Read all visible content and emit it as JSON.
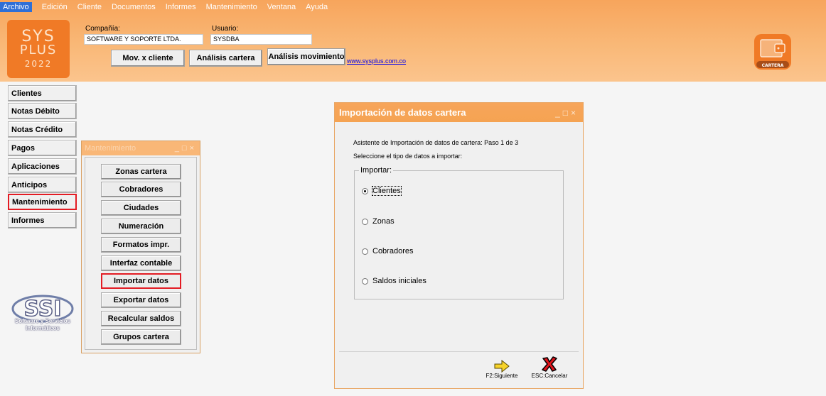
{
  "menu": [
    "Archivo",
    "Edición",
    "Cliente",
    "Documentos",
    "Informes",
    "Mantenimiento",
    "Ventana",
    "Ayuda"
  ],
  "logo": {
    "line1": "SYS",
    "line2": "PLUS",
    "line3": "2022"
  },
  "header": {
    "company_label": "Compañía:",
    "company_value": "SOFTWARE Y SOPORTE LTDA.",
    "user_label": "Usuario:",
    "user_value": "SYSDBA",
    "buttons": [
      "Mov. x cliente",
      "Análisis cartera",
      "Análisis movimiento"
    ],
    "link": "www.sysplus.com.co",
    "module_badge": "CARTERA"
  },
  "nav": [
    "Clientes",
    "Notas Débito",
    "Notas Crédito",
    "Pagos",
    "Aplicaciones",
    "Anticipos",
    "Mantenimiento",
    "Informes"
  ],
  "nav_highlight": "Mantenimiento",
  "brand": {
    "logo_text": "SSI",
    "caption_line1": "Software y Servicios",
    "caption_line2": "Informáticos"
  },
  "maintenance_window": {
    "title": "Mantenimiento",
    "buttons": [
      "Zonas cartera",
      "Cobradores",
      "Ciudades",
      "Numeración",
      "Formatos impr.",
      "Interfaz contable",
      "Importar datos",
      "Exportar datos",
      "Recalcular saldos",
      "Grupos cartera"
    ],
    "highlight": "Importar datos"
  },
  "import_dialog": {
    "title": "Importación de datos cartera",
    "step_text": "Asistente de Importación de datos de cartera: Paso 1 de 3",
    "prompt": "Seleccione el tipo de datos a importar:",
    "group_label": "Importar:",
    "options": [
      "Clientes",
      "Zonas",
      "Cobradores",
      "Saldos iniciales"
    ],
    "selected": "Clientes",
    "next_label": "F2:Siguiente",
    "cancel_label": "ESC:Cancelar"
  },
  "colors": {
    "accent": "#f7a55c",
    "highlight": "#e31b23",
    "logo_bg": "#f07a26"
  }
}
